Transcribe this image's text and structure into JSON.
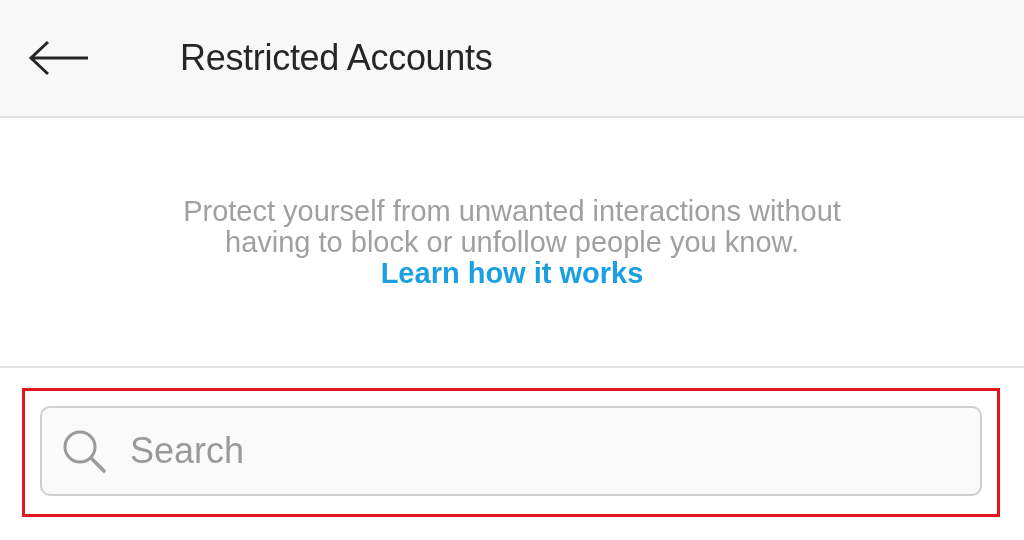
{
  "header": {
    "title": "Restricted Accounts"
  },
  "description": {
    "text": "Protect yourself from unwanted interactions without having to block or unfollow people you know.",
    "link": "Learn how it works"
  },
  "search": {
    "placeholder": "Search",
    "highlighted": true
  }
}
